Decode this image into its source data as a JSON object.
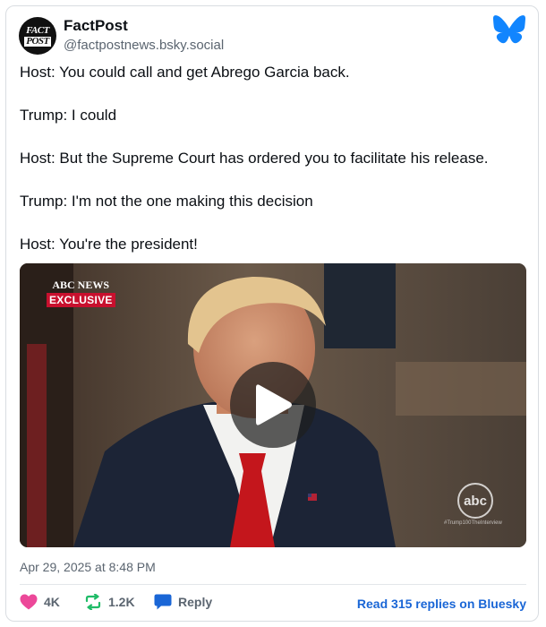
{
  "author": {
    "name": "FactPost",
    "handle": "@factpostnews.bsky.social",
    "avatar_text_line1": "FACT",
    "avatar_text_line2": "POST"
  },
  "post": {
    "lines": [
      "Host: You could call and get Abrego Garcia back.",
      "Trump: I could",
      "Host: But the Supreme Court has ordered you to facilitate his release.",
      "Trump: I'm not the one making this decision",
      "Host: You're the president!"
    ]
  },
  "video": {
    "network_label": "ABC NEWS",
    "badge": "EXCLUSIVE",
    "watermark": "abc",
    "hashtag": "#Trump100TheInterview"
  },
  "timestamp": "Apr 29, 2025 at 8:48 PM",
  "actions": {
    "likes": "4K",
    "reposts": "1.2K",
    "reply_label": "Reply",
    "read_replies": "Read 315 replies on Bluesky"
  },
  "colors": {
    "like": "#ec4899",
    "repost": "#20bc68",
    "reply": "#1a66d6",
    "link": "#1a66d6",
    "bluesky": "#1185fe"
  }
}
